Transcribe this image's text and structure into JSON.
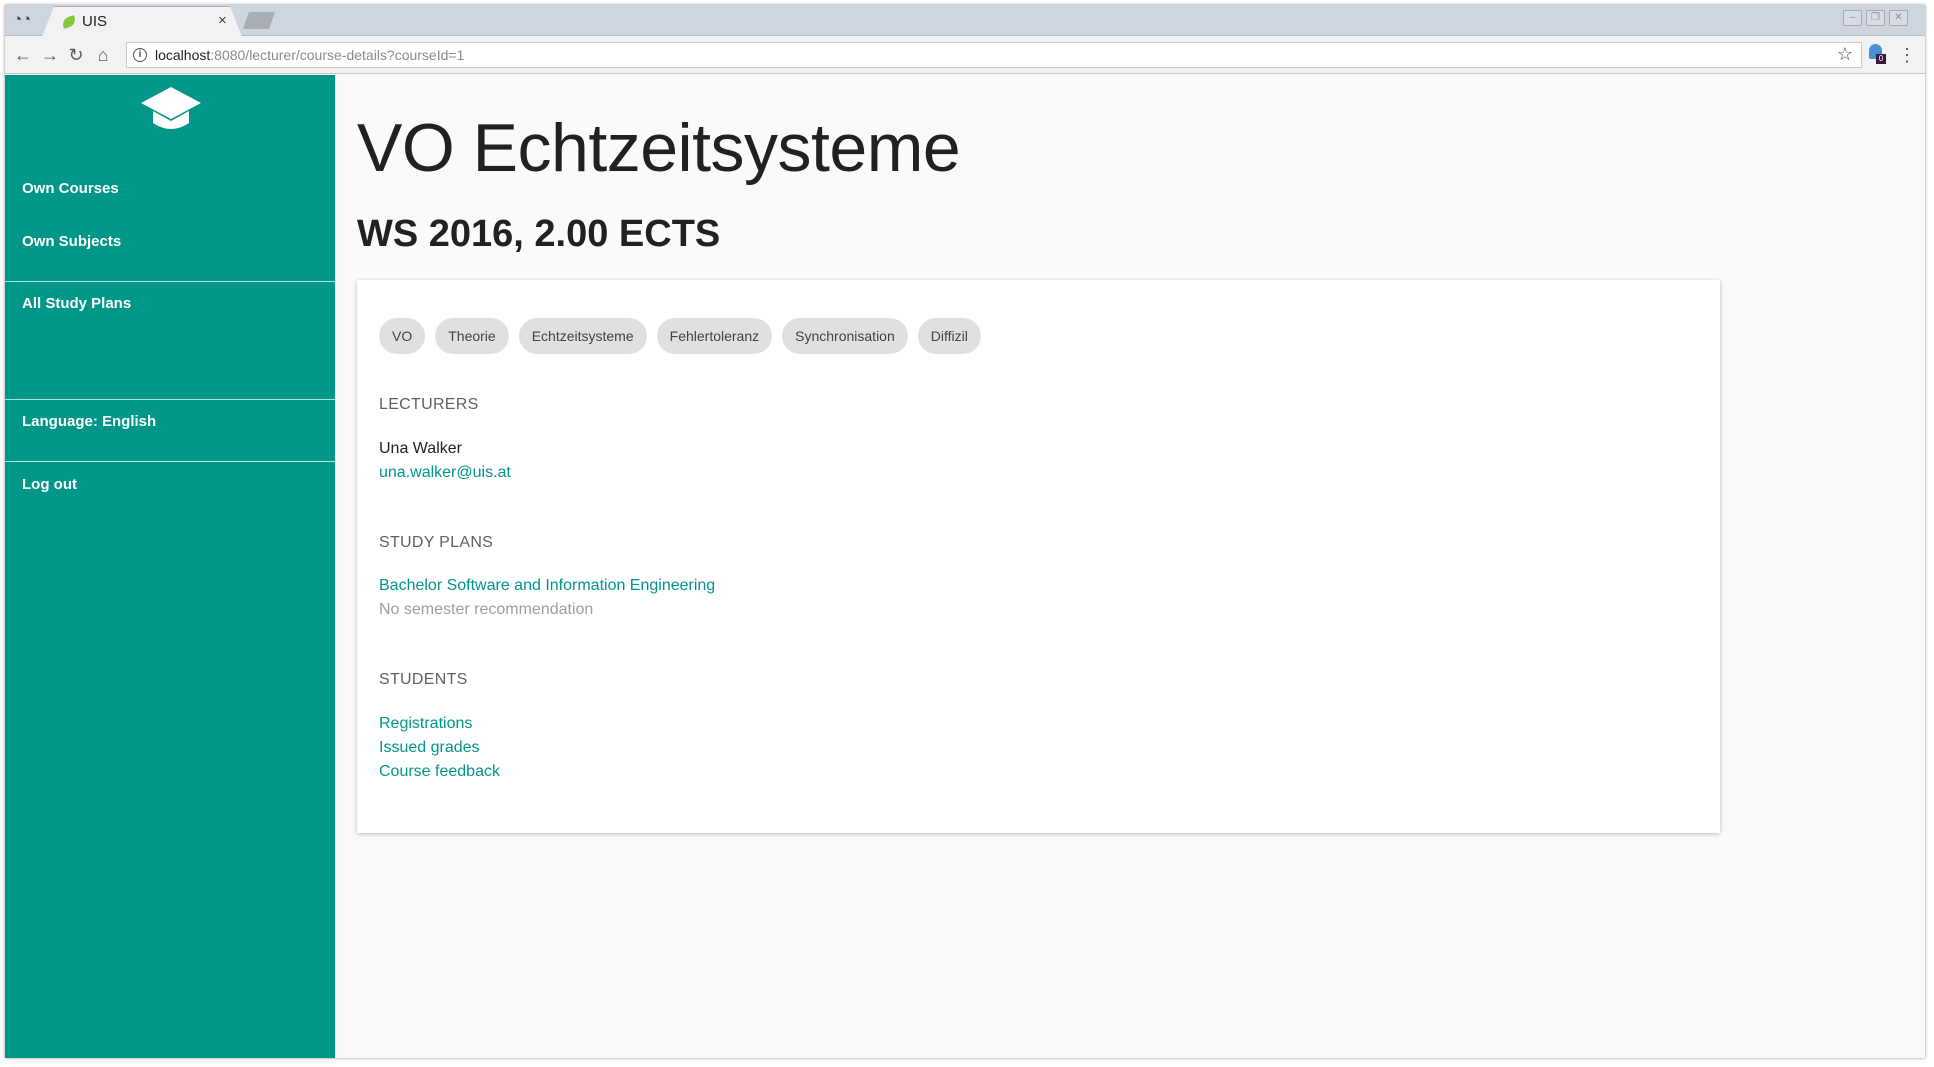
{
  "browser": {
    "tab_title": "UIS",
    "tab_close": "×",
    "url_host": "localhost",
    "url_path": ":8080/lecturer/course-details?courseId=1",
    "extension_badge": "0"
  },
  "sidebar": {
    "items": [
      {
        "label": "Own Courses"
      },
      {
        "label": "Own Subjects"
      },
      {
        "label": "All Study Plans"
      },
      {
        "label": "Language: English"
      },
      {
        "label": "Log out"
      }
    ]
  },
  "course": {
    "title": "VO Echtzeitsysteme",
    "subtitle": "WS 2016, 2.00 ECTS",
    "tags": [
      "VO",
      "Theorie",
      "Echtzeitsysteme",
      "Fehlertoleranz",
      "Synchronisation",
      "Diffizil"
    ],
    "lecturers": {
      "heading": "LECTURERS",
      "name": "Una Walker",
      "email": "una.walker@uis.at"
    },
    "study_plans": {
      "heading": "STUDY PLANS",
      "plan_name": "Bachelor Software and Information Engineering",
      "recommendation": "No semester recommendation"
    },
    "students": {
      "heading": "STUDENTS",
      "links": [
        "Registrations",
        "Issued grades",
        "Course feedback"
      ]
    }
  },
  "colors": {
    "accent": "#009688",
    "title_text": "#212121",
    "muted_text": "#9e9e9e",
    "tag_background": "#e0e0e0"
  }
}
